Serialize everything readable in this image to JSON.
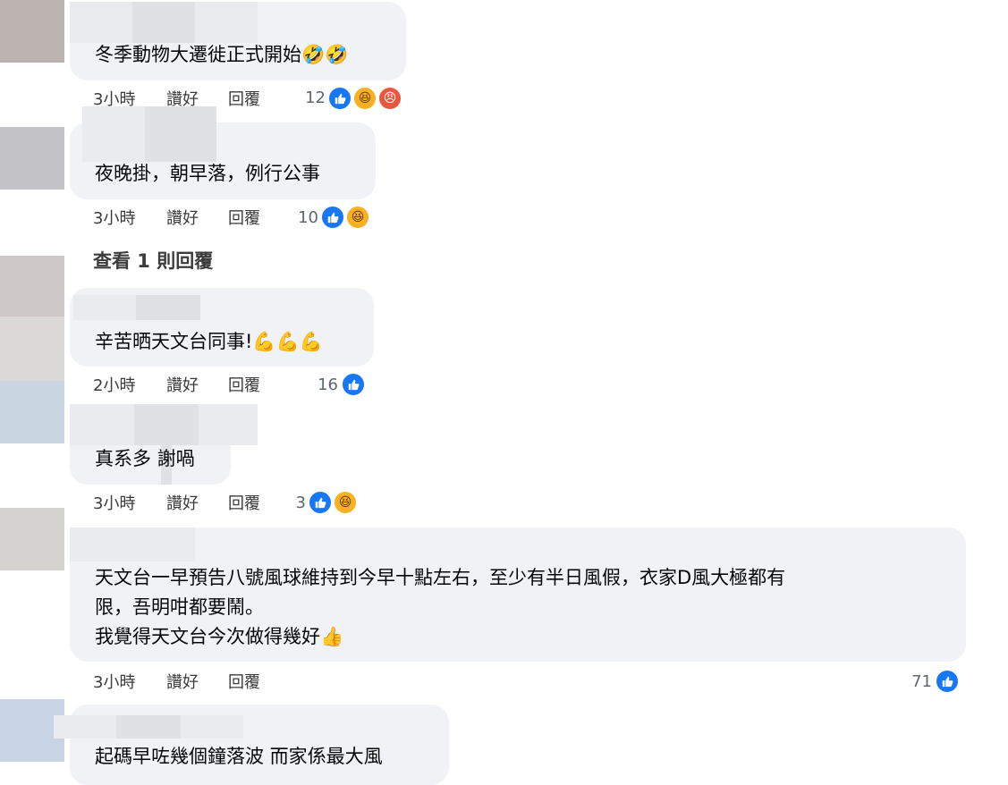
{
  "comments": [
    {
      "text_lines": [
        "冬季動物大遷徙正式開始🤣🤣"
      ],
      "time": "3小時",
      "like_label": "讚好",
      "reply_label": "回覆",
      "reaction_count": "12",
      "reactions": [
        "like",
        "haha",
        "angry"
      ]
    },
    {
      "text_lines": [
        "夜晚掛，朝早落，例行公事"
      ],
      "time": "3小時",
      "like_label": "讚好",
      "reply_label": "回覆",
      "reaction_count": "10",
      "reactions": [
        "like",
        "haha"
      ]
    },
    {
      "text_lines": [
        "辛苦晒天文台同事!💪💪💪"
      ],
      "time": "2小時",
      "like_label": "讚好",
      "reply_label": "回覆",
      "reaction_count": "16",
      "reactions": [
        "like"
      ]
    },
    {
      "text_lines": [
        "真系多 謝喎"
      ],
      "time": "3小時",
      "like_label": "讚好",
      "reply_label": "回覆",
      "reaction_count": "3",
      "reactions": [
        "like",
        "haha"
      ]
    },
    {
      "text_lines": [
        "天文台一早預告八號風球維持到今早十點左右，至少有半日風假，衣家D風大極都有",
        "限，吾明咁都要鬧。",
        "我覺得天文台今次做得幾好👍"
      ],
      "time": "3小時",
      "like_label": "讚好",
      "reply_label": "回覆",
      "reaction_count": "71",
      "reactions": [
        "like"
      ]
    },
    {
      "text_lines": [
        "起碼早咗幾個鐘落波 而家係最大風"
      ]
    }
  ],
  "view_replies": "查看 1 則回覆",
  "colors": {
    "bubble": "#f0f2f5",
    "like_blue": "#1877f2",
    "haha_yellow": "#f7b125",
    "angry_red": "#e9573f"
  }
}
